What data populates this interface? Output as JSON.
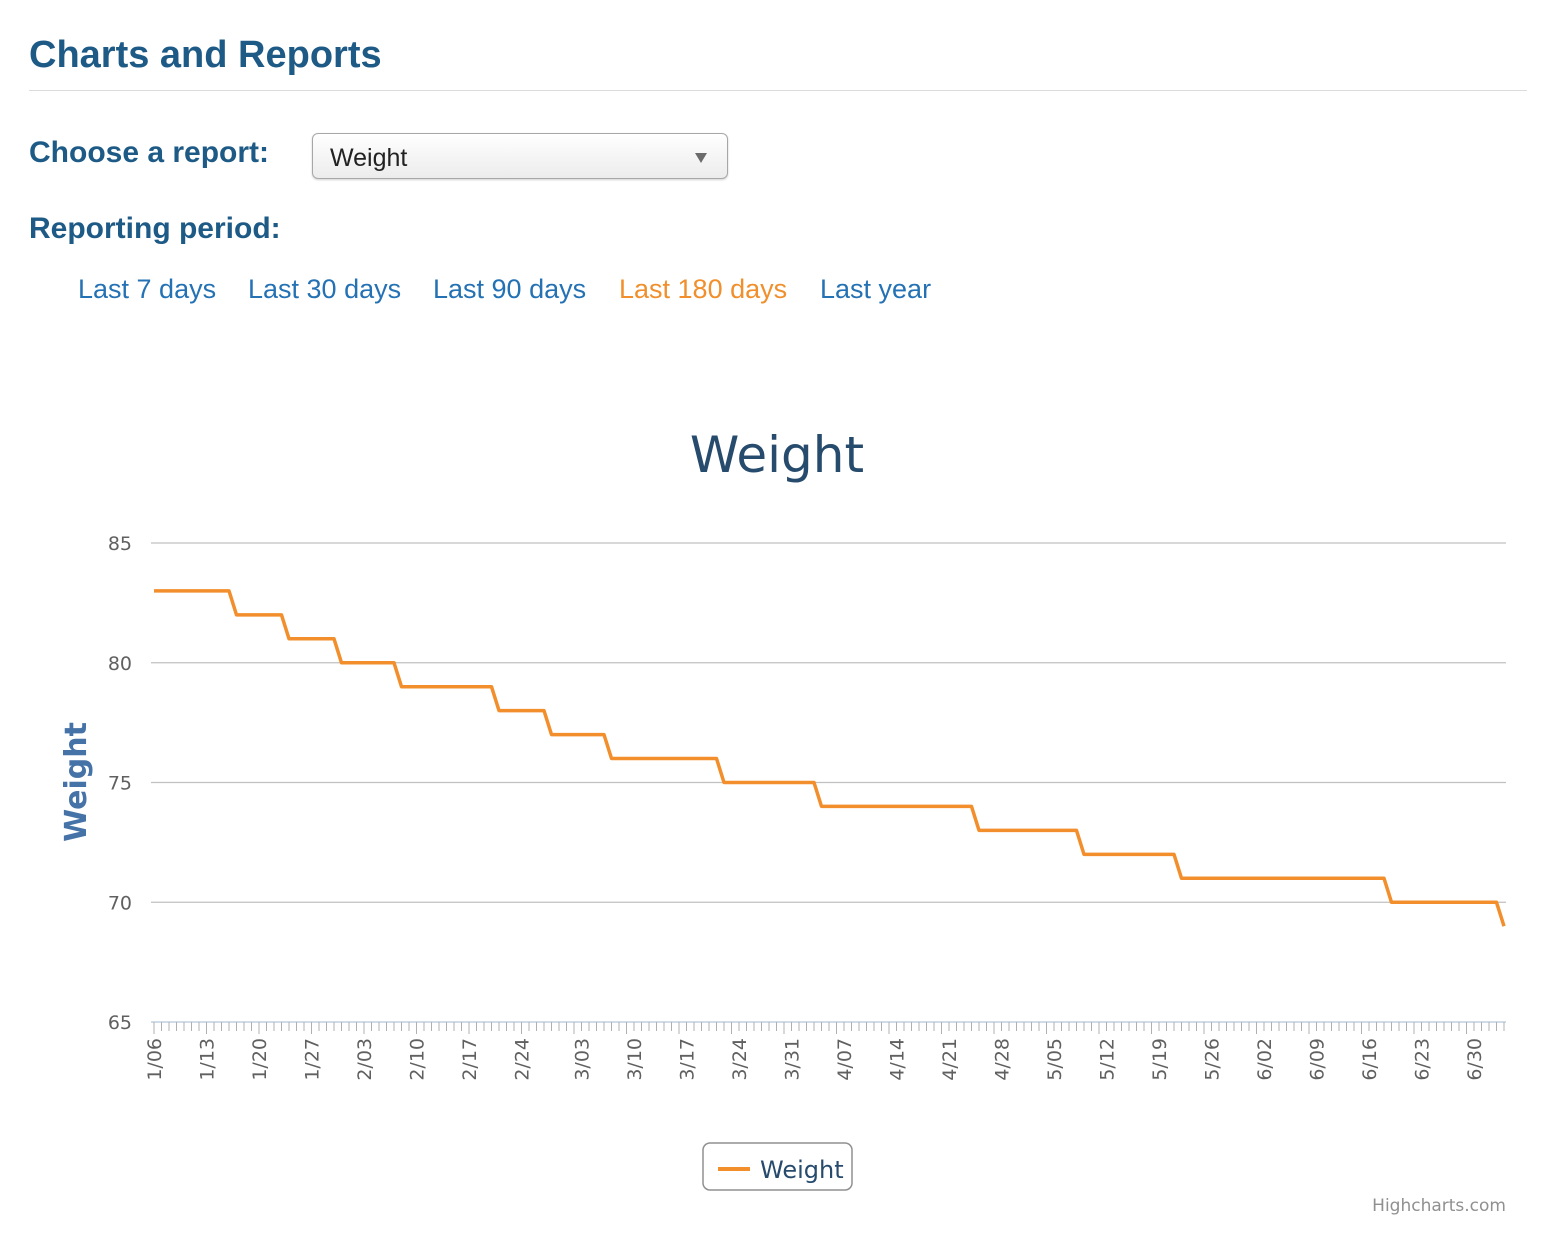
{
  "page": {
    "title": "Charts and Reports",
    "choose_label": "Choose a report:",
    "report_select": {
      "value": "Weight"
    },
    "period_label": "Reporting period:",
    "periods": [
      {
        "label": "Last 7 days",
        "active": false
      },
      {
        "label": "Last 30 days",
        "active": false
      },
      {
        "label": "Last 90 days",
        "active": false
      },
      {
        "label": "Last 180 days",
        "active": true
      },
      {
        "label": "Last year",
        "active": false
      }
    ],
    "colors": {
      "heading": "#1d5a86",
      "link": "#2471b4",
      "active_link": "#f08f2c"
    }
  },
  "chart_data": {
    "type": "line",
    "title": "Weight",
    "ylabel": "Weight",
    "ylim": [
      65,
      85
    ],
    "yticks": [
      65,
      70,
      75,
      80,
      85
    ],
    "grid": true,
    "legend_position": "bottom-center",
    "credits": "Highcharts.com",
    "x_tick_labels": [
      "1/06",
      "1/13",
      "1/20",
      "1/27",
      "2/03",
      "2/10",
      "2/17",
      "2/24",
      "3/03",
      "3/10",
      "3/17",
      "3/24",
      "3/31",
      "4/07",
      "4/14",
      "4/21",
      "4/28",
      "5/05",
      "5/12",
      "5/19",
      "5/26",
      "6/02",
      "6/09",
      "6/16",
      "6/23",
      "6/30"
    ],
    "series": [
      {
        "name": "Weight",
        "color": "#f28f2c",
        "points": [
          [
            "1/06",
            83
          ],
          [
            "1/16",
            83
          ],
          [
            "1/17",
            82
          ],
          [
            "1/23",
            82
          ],
          [
            "1/24",
            81
          ],
          [
            "1/30",
            81
          ],
          [
            "1/31",
            80
          ],
          [
            "2/07",
            80
          ],
          [
            "2/08",
            79
          ],
          [
            "2/20",
            79
          ],
          [
            "2/21",
            78
          ],
          [
            "2/27",
            78
          ],
          [
            "2/28",
            77
          ],
          [
            "3/06",
            77
          ],
          [
            "3/07",
            76
          ],
          [
            "3/21",
            76
          ],
          [
            "3/22",
            75
          ],
          [
            "4/03",
            75
          ],
          [
            "4/04",
            74
          ],
          [
            "4/24",
            74
          ],
          [
            "4/25",
            73
          ],
          [
            "5/08",
            73
          ],
          [
            "5/09",
            72
          ],
          [
            "5/21",
            72
          ],
          [
            "5/22",
            71
          ],
          [
            "6/18",
            71
          ],
          [
            "6/19",
            70
          ],
          [
            "7/03",
            70
          ],
          [
            "7/04",
            69
          ]
        ]
      }
    ]
  }
}
